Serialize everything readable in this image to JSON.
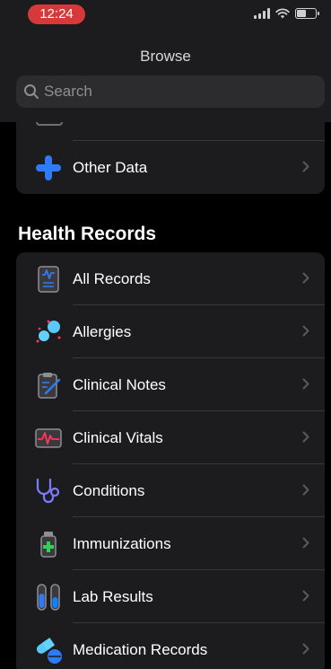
{
  "status_bar": {
    "time": "12:24",
    "battery_level": 0.55
  },
  "nav": {
    "title": "Browse"
  },
  "search": {
    "placeholder": "Search"
  },
  "other_data": {
    "label": "Other Data"
  },
  "health_records": {
    "title": "Health Records",
    "items": [
      {
        "label": "All Records",
        "icon": "all-records-icon"
      },
      {
        "label": "Allergies",
        "icon": "allergies-icon"
      },
      {
        "label": "Clinical Notes",
        "icon": "clinical-notes-icon"
      },
      {
        "label": "Clinical Vitals",
        "icon": "clinical-vitals-icon"
      },
      {
        "label": "Conditions",
        "icon": "stethoscope-icon"
      },
      {
        "label": "Immunizations",
        "icon": "vaccine-vial-icon"
      },
      {
        "label": "Lab Results",
        "icon": "test-tubes-icon"
      },
      {
        "label": "Medication Records",
        "icon": "pill-icon"
      }
    ]
  },
  "colors": {
    "background": "#000000",
    "card": "#1c1c1e",
    "accent_blue": "#2f7bf6",
    "time_pill": "#d7393a"
  }
}
